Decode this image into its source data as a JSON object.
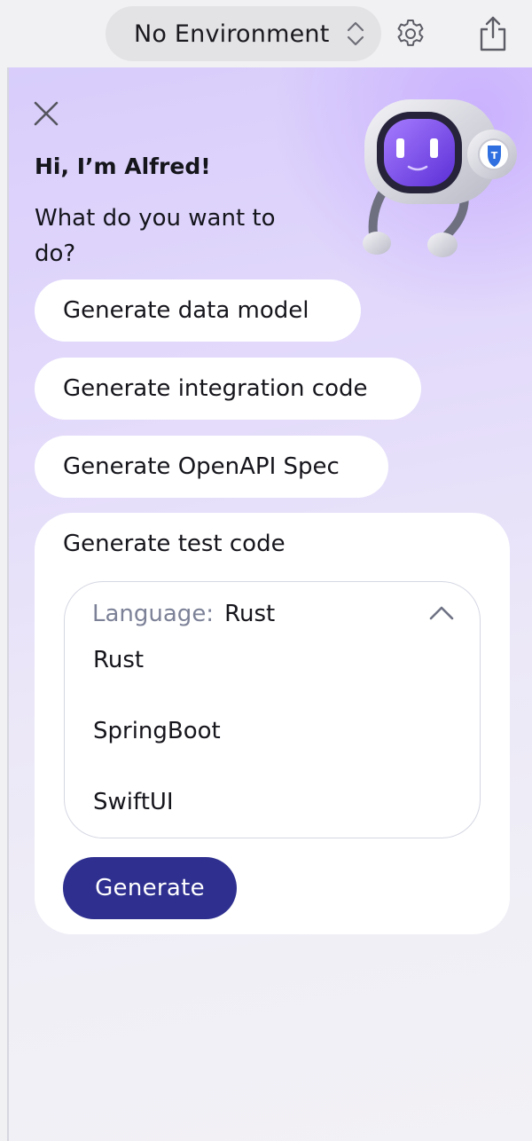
{
  "topbar": {
    "environment_label": "No Environment",
    "icons": {
      "environment_chevrons": "up-down-chevron-icon",
      "settings": "gear-icon",
      "share": "share-icon"
    }
  },
  "assistant": {
    "close_icon": "close-icon",
    "greeting": "Hi, I’m Alfred!",
    "question": "What do you want to do?",
    "mascot": "robot-mascot",
    "actions": [
      {
        "label": "Generate data model"
      },
      {
        "label": "Generate integration code"
      },
      {
        "label": "Generate OpenAPI Spec"
      }
    ],
    "test_code": {
      "title": "Generate test code",
      "language_label": "Language:",
      "language_value": "Rust",
      "language_options": [
        "Rust",
        "SpringBoot",
        "SwiftUI"
      ],
      "generate_label": "Generate"
    }
  },
  "colors": {
    "accent_button": "#2e2f8f",
    "panel_gradient_top": "#d8cdfb",
    "panel_gradient_bottom": "#f2f1f5",
    "muted_label": "#7c8197"
  }
}
